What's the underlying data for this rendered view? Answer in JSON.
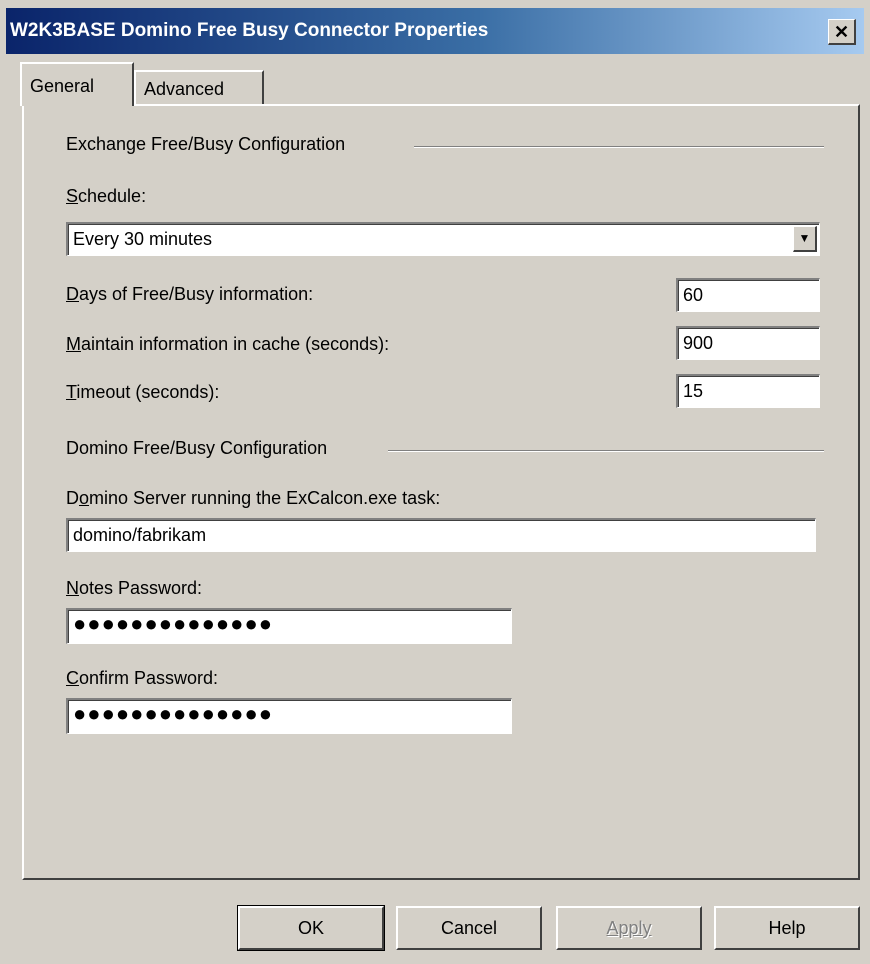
{
  "window": {
    "title": "W2K3BASE Domino Free Busy Connector Properties",
    "close_glyph": "✕"
  },
  "tabs": [
    {
      "label": "General",
      "active": true
    },
    {
      "label": "Advanced",
      "active": false
    }
  ],
  "exchange": {
    "header": "Exchange Free/Busy Configuration",
    "schedule_label_key": "S",
    "schedule_label_rest": "chedule:",
    "schedule_value": "Every 30 minutes",
    "days_label_key": "D",
    "days_label_rest": "ays of Free/Busy information:",
    "days_value": "60",
    "cache_label_key": "M",
    "cache_label_rest": "aintain information in cache (seconds):",
    "cache_value": "900",
    "timeout_label_key": "T",
    "timeout_label_rest": "imeout (seconds):",
    "timeout_value": "15"
  },
  "domino": {
    "header": "Domino Free/Busy Configuration",
    "server_label_pre": "D",
    "server_label_key": "o",
    "server_label_rest": "mino Server running the ExCalcon.exe task:",
    "server_value": "domino/fabrikam",
    "notes_pw_label_key": "N",
    "notes_pw_label_rest": "otes Password:",
    "notes_pw_value": "●●●●●●●●●●●●●●",
    "confirm_pw_label_key": "C",
    "confirm_pw_label_rest": "onfirm Password:",
    "confirm_pw_value": "●●●●●●●●●●●●●●"
  },
  "buttons": {
    "ok": "OK",
    "cancel": "Cancel",
    "apply": "Apply",
    "help": "Help"
  },
  "colors": {
    "title_start": "#0a246a",
    "title_end": "#a6caf0",
    "face": "#d4d0c8"
  },
  "icons": {
    "close": "close-icon",
    "dropdown": "chevron-down-icon"
  }
}
